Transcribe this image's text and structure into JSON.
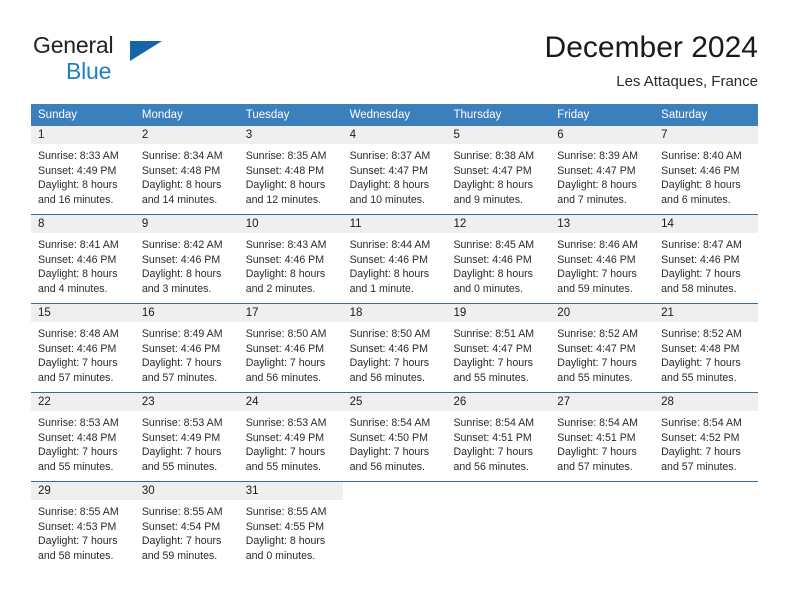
{
  "brand": {
    "line1": "General",
    "line2": "Blue",
    "triangle_color": "#1565a8",
    "blue_color": "#1f7fc4"
  },
  "header": {
    "title": "December 2024",
    "subtitle": "Les Attaques, France"
  },
  "theme": {
    "header_blue": "#3c7fbd",
    "divider_blue": "#2e6da4",
    "day_band_gray": "#efefef"
  },
  "weekdays": [
    "Sunday",
    "Monday",
    "Tuesday",
    "Wednesday",
    "Thursday",
    "Friday",
    "Saturday"
  ],
  "weeks": [
    [
      {
        "day": "1",
        "sunrise": "Sunrise: 8:33 AM",
        "sunset": "Sunset: 4:49 PM",
        "daylight1": "Daylight: 8 hours",
        "daylight2": "and 16 minutes."
      },
      {
        "day": "2",
        "sunrise": "Sunrise: 8:34 AM",
        "sunset": "Sunset: 4:48 PM",
        "daylight1": "Daylight: 8 hours",
        "daylight2": "and 14 minutes."
      },
      {
        "day": "3",
        "sunrise": "Sunrise: 8:35 AM",
        "sunset": "Sunset: 4:48 PM",
        "daylight1": "Daylight: 8 hours",
        "daylight2": "and 12 minutes."
      },
      {
        "day": "4",
        "sunrise": "Sunrise: 8:37 AM",
        "sunset": "Sunset: 4:47 PM",
        "daylight1": "Daylight: 8 hours",
        "daylight2": "and 10 minutes."
      },
      {
        "day": "5",
        "sunrise": "Sunrise: 8:38 AM",
        "sunset": "Sunset: 4:47 PM",
        "daylight1": "Daylight: 8 hours",
        "daylight2": "and 9 minutes."
      },
      {
        "day": "6",
        "sunrise": "Sunrise: 8:39 AM",
        "sunset": "Sunset: 4:47 PM",
        "daylight1": "Daylight: 8 hours",
        "daylight2": "and 7 minutes."
      },
      {
        "day": "7",
        "sunrise": "Sunrise: 8:40 AM",
        "sunset": "Sunset: 4:46 PM",
        "daylight1": "Daylight: 8 hours",
        "daylight2": "and 6 minutes."
      }
    ],
    [
      {
        "day": "8",
        "sunrise": "Sunrise: 8:41 AM",
        "sunset": "Sunset: 4:46 PM",
        "daylight1": "Daylight: 8 hours",
        "daylight2": "and 4 minutes."
      },
      {
        "day": "9",
        "sunrise": "Sunrise: 8:42 AM",
        "sunset": "Sunset: 4:46 PM",
        "daylight1": "Daylight: 8 hours",
        "daylight2": "and 3 minutes."
      },
      {
        "day": "10",
        "sunrise": "Sunrise: 8:43 AM",
        "sunset": "Sunset: 4:46 PM",
        "daylight1": "Daylight: 8 hours",
        "daylight2": "and 2 minutes."
      },
      {
        "day": "11",
        "sunrise": "Sunrise: 8:44 AM",
        "sunset": "Sunset: 4:46 PM",
        "daylight1": "Daylight: 8 hours",
        "daylight2": "and 1 minute."
      },
      {
        "day": "12",
        "sunrise": "Sunrise: 8:45 AM",
        "sunset": "Sunset: 4:46 PM",
        "daylight1": "Daylight: 8 hours",
        "daylight2": "and 0 minutes."
      },
      {
        "day": "13",
        "sunrise": "Sunrise: 8:46 AM",
        "sunset": "Sunset: 4:46 PM",
        "daylight1": "Daylight: 7 hours",
        "daylight2": "and 59 minutes."
      },
      {
        "day": "14",
        "sunrise": "Sunrise: 8:47 AM",
        "sunset": "Sunset: 4:46 PM",
        "daylight1": "Daylight: 7 hours",
        "daylight2": "and 58 minutes."
      }
    ],
    [
      {
        "day": "15",
        "sunrise": "Sunrise: 8:48 AM",
        "sunset": "Sunset: 4:46 PM",
        "daylight1": "Daylight: 7 hours",
        "daylight2": "and 57 minutes."
      },
      {
        "day": "16",
        "sunrise": "Sunrise: 8:49 AM",
        "sunset": "Sunset: 4:46 PM",
        "daylight1": "Daylight: 7 hours",
        "daylight2": "and 57 minutes."
      },
      {
        "day": "17",
        "sunrise": "Sunrise: 8:50 AM",
        "sunset": "Sunset: 4:46 PM",
        "daylight1": "Daylight: 7 hours",
        "daylight2": "and 56 minutes."
      },
      {
        "day": "18",
        "sunrise": "Sunrise: 8:50 AM",
        "sunset": "Sunset: 4:46 PM",
        "daylight1": "Daylight: 7 hours",
        "daylight2": "and 56 minutes."
      },
      {
        "day": "19",
        "sunrise": "Sunrise: 8:51 AM",
        "sunset": "Sunset: 4:47 PM",
        "daylight1": "Daylight: 7 hours",
        "daylight2": "and 55 minutes."
      },
      {
        "day": "20",
        "sunrise": "Sunrise: 8:52 AM",
        "sunset": "Sunset: 4:47 PM",
        "daylight1": "Daylight: 7 hours",
        "daylight2": "and 55 minutes."
      },
      {
        "day": "21",
        "sunrise": "Sunrise: 8:52 AM",
        "sunset": "Sunset: 4:48 PM",
        "daylight1": "Daylight: 7 hours",
        "daylight2": "and 55 minutes."
      }
    ],
    [
      {
        "day": "22",
        "sunrise": "Sunrise: 8:53 AM",
        "sunset": "Sunset: 4:48 PM",
        "daylight1": "Daylight: 7 hours",
        "daylight2": "and 55 minutes."
      },
      {
        "day": "23",
        "sunrise": "Sunrise: 8:53 AM",
        "sunset": "Sunset: 4:49 PM",
        "daylight1": "Daylight: 7 hours",
        "daylight2": "and 55 minutes."
      },
      {
        "day": "24",
        "sunrise": "Sunrise: 8:53 AM",
        "sunset": "Sunset: 4:49 PM",
        "daylight1": "Daylight: 7 hours",
        "daylight2": "and 55 minutes."
      },
      {
        "day": "25",
        "sunrise": "Sunrise: 8:54 AM",
        "sunset": "Sunset: 4:50 PM",
        "daylight1": "Daylight: 7 hours",
        "daylight2": "and 56 minutes."
      },
      {
        "day": "26",
        "sunrise": "Sunrise: 8:54 AM",
        "sunset": "Sunset: 4:51 PM",
        "daylight1": "Daylight: 7 hours",
        "daylight2": "and 56 minutes."
      },
      {
        "day": "27",
        "sunrise": "Sunrise: 8:54 AM",
        "sunset": "Sunset: 4:51 PM",
        "daylight1": "Daylight: 7 hours",
        "daylight2": "and 57 minutes."
      },
      {
        "day": "28",
        "sunrise": "Sunrise: 8:54 AM",
        "sunset": "Sunset: 4:52 PM",
        "daylight1": "Daylight: 7 hours",
        "daylight2": "and 57 minutes."
      }
    ],
    [
      {
        "day": "29",
        "sunrise": "Sunrise: 8:55 AM",
        "sunset": "Sunset: 4:53 PM",
        "daylight1": "Daylight: 7 hours",
        "daylight2": "and 58 minutes."
      },
      {
        "day": "30",
        "sunrise": "Sunrise: 8:55 AM",
        "sunset": "Sunset: 4:54 PM",
        "daylight1": "Daylight: 7 hours",
        "daylight2": "and 59 minutes."
      },
      {
        "day": "31",
        "sunrise": "Sunrise: 8:55 AM",
        "sunset": "Sunset: 4:55 PM",
        "daylight1": "Daylight: 8 hours",
        "daylight2": "and 0 minutes."
      },
      {
        "day": "",
        "sunrise": "",
        "sunset": "",
        "daylight1": "",
        "daylight2": ""
      },
      {
        "day": "",
        "sunrise": "",
        "sunset": "",
        "daylight1": "",
        "daylight2": ""
      },
      {
        "day": "",
        "sunrise": "",
        "sunset": "",
        "daylight1": "",
        "daylight2": ""
      },
      {
        "day": "",
        "sunrise": "",
        "sunset": "",
        "daylight1": "",
        "daylight2": ""
      }
    ]
  ]
}
